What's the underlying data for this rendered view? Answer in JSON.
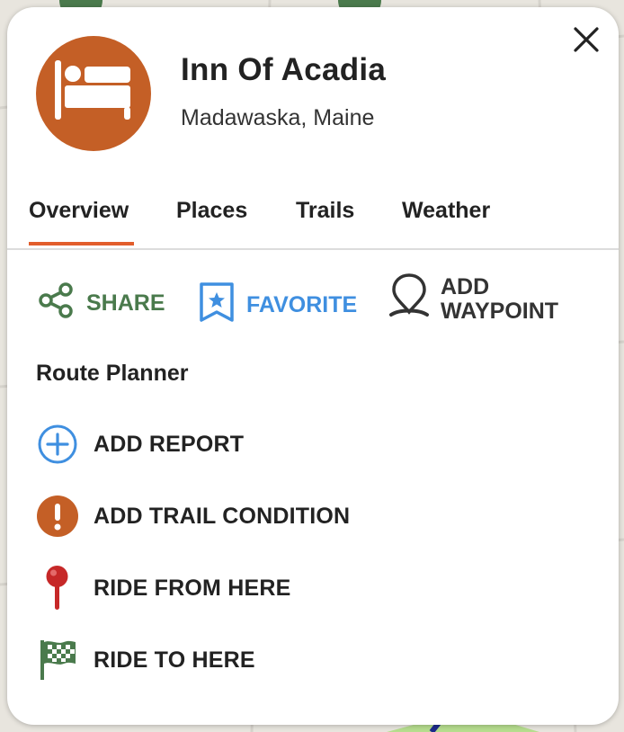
{
  "place": {
    "title": "Inn Of Acadia",
    "subtitle": "Madawaska, Maine",
    "category_icon": "bed-icon",
    "accent_color": "#c45f26"
  },
  "tabs": [
    {
      "label": "Overview",
      "active": true
    },
    {
      "label": "Places"
    },
    {
      "label": "Trails"
    },
    {
      "label": "Weather"
    }
  ],
  "tab_indicator_color": "#e25d2b",
  "actions": {
    "share": {
      "label": "SHARE",
      "icon": "share-icon",
      "color": "#4a7a4c"
    },
    "favorite": {
      "label": "FAVORITE",
      "icon": "bookmark-star-icon",
      "color": "#3f8fe0"
    },
    "waypoint": {
      "label_line1": "ADD",
      "label_line2": "WAYPOINT",
      "icon": "waypoint-pin-icon",
      "color": "#333333"
    }
  },
  "route_planner": {
    "title": "Route Planner",
    "items": [
      {
        "label": "ADD REPORT",
        "icon": "plus-circle-icon",
        "color": "#3f8fe0"
      },
      {
        "label": "ADD TRAIL CONDITION",
        "icon": "alert-circle-icon",
        "color": "#c45f26"
      },
      {
        "label": "RIDE FROM HERE",
        "icon": "map-pin-icon",
        "color": "#c62828"
      },
      {
        "label": "RIDE TO HERE",
        "icon": "checkered-flag-icon",
        "color": "#4a7a4c"
      }
    ]
  }
}
